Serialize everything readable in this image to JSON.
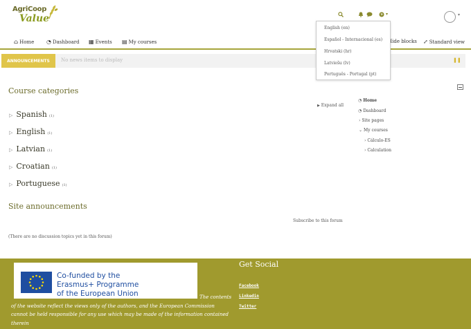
{
  "brand": {
    "line1": "AgriCoop",
    "line2": "Value"
  },
  "toolbar": {
    "search_icon": "search-icon",
    "bell_icon": "bell-icon",
    "chat_icon": "chat-icon",
    "globe_icon": "globe-icon"
  },
  "nav": {
    "home": "Home",
    "dashboard": "Dashboard",
    "events": "Events",
    "my_courses": "My courses",
    "hide_blocks": "Hide blocks",
    "standard_view": "Standard view"
  },
  "language_menu": [
    "English (en)",
    "Español - Internacional (es)",
    "Hrvatski (hr)",
    "Latviešu (lv)",
    "Português - Portugal (pt)"
  ],
  "announcements_bar": {
    "label": "ANNOUNCEMENTS",
    "text": "No news items to display"
  },
  "course_categories": {
    "title": "Course categories",
    "expand_all": "Expand all",
    "items": [
      {
        "name": "Spanish",
        "count": "(1)"
      },
      {
        "name": "English",
        "count": "(1)"
      },
      {
        "name": "Latvian",
        "count": "(1)"
      },
      {
        "name": "Croatian",
        "count": "(1)"
      },
      {
        "name": "Portuguese",
        "count": "(1)"
      }
    ]
  },
  "site_announcements": {
    "title": "Site announcements",
    "subscribe": "Subscribe to this forum",
    "empty": "(There are no discussion topics yet in this forum)"
  },
  "navigation_block": {
    "home": "Home",
    "dashboard": "Dashboard",
    "site_pages": "Site pages",
    "my_courses": "My courses",
    "course1": "Cálculo-ES",
    "course2": "Calculation"
  },
  "footer": {
    "eu_text": "Co-funded by the\nErasmus+ Programme\nof the European Union",
    "disclaimer": "The contents of the website reflect the views only of the authors, and the European  Commission cannot be held responsible for any use which may be made of the  information contained therein",
    "social_title": "Get Social",
    "links": [
      "Facebook",
      "Linkedin",
      "Twitter"
    ]
  },
  "colors": {
    "olive": "#a09a2e",
    "accent_yellow": "#e0c54a",
    "eu_blue": "#1f4ea0"
  }
}
